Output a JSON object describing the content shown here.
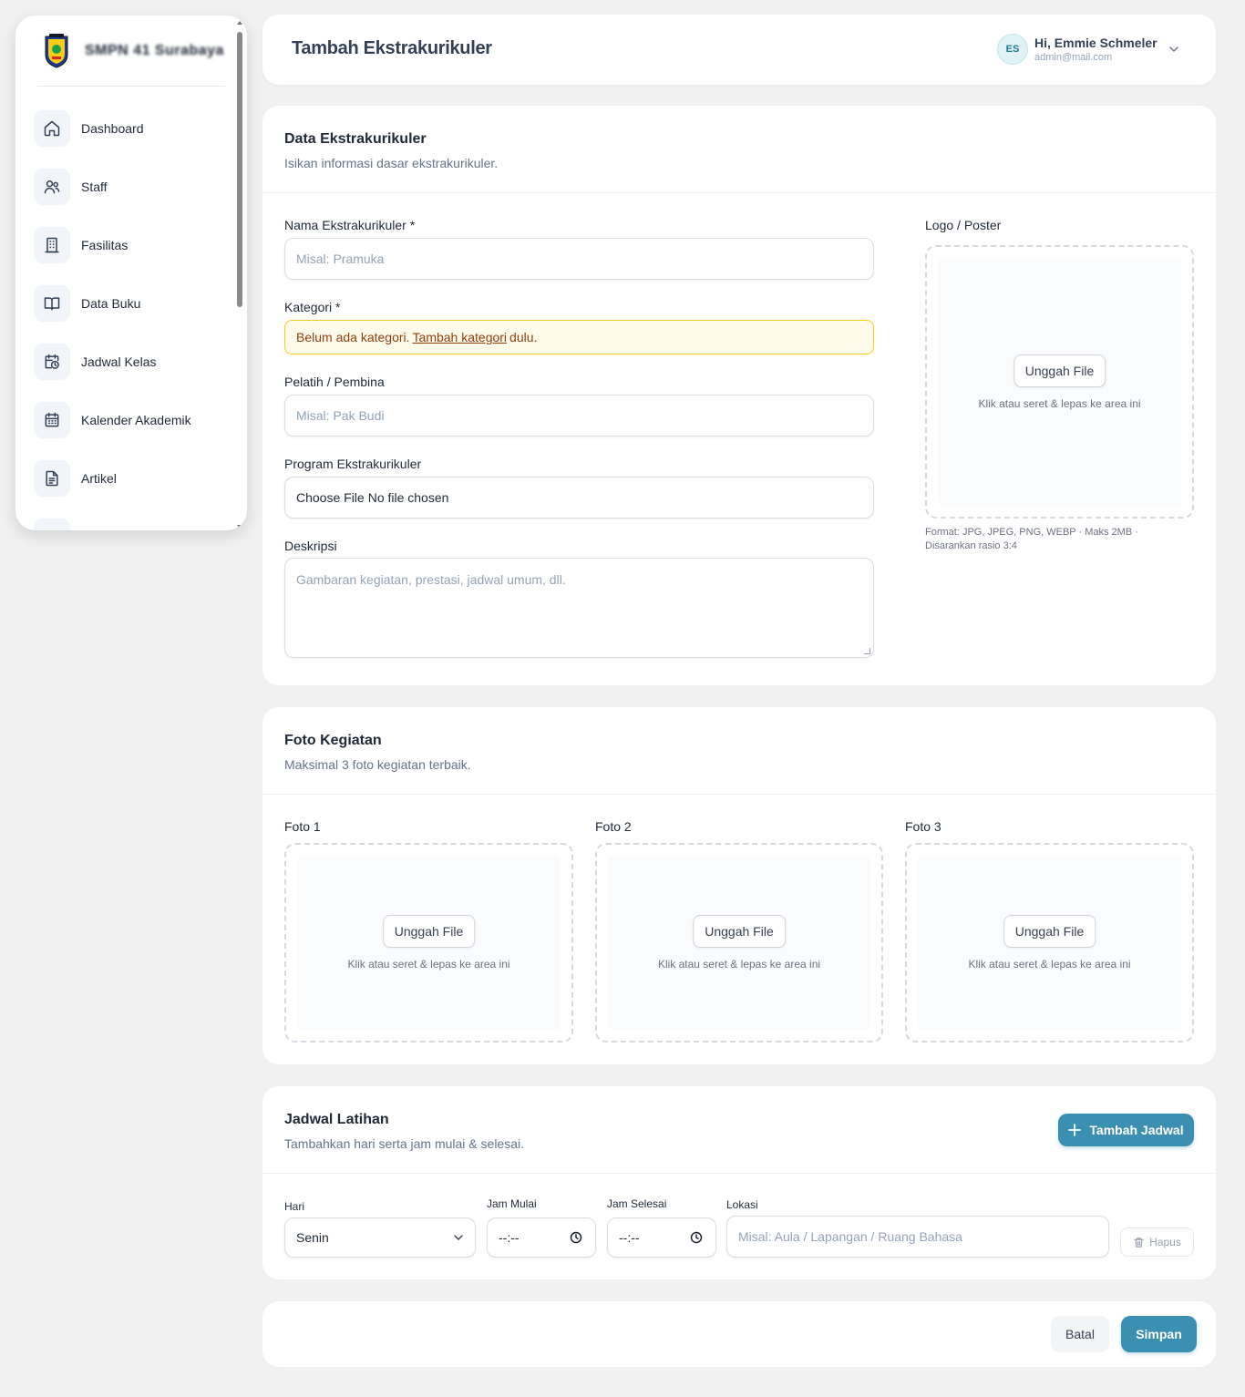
{
  "sidebar": {
    "brand": "SMPN 41 Surabaya",
    "items": [
      {
        "label": "Dashboard",
        "icon": "home-icon"
      },
      {
        "label": "Staff",
        "icon": "users-icon"
      },
      {
        "label": "Fasilitas",
        "icon": "building-icon"
      },
      {
        "label": "Data Buku",
        "icon": "book-open-icon"
      },
      {
        "label": "Jadwal Kelas",
        "icon": "calendar-clock-icon"
      },
      {
        "label": "Kalender Akademik",
        "icon": "calendar-icon"
      },
      {
        "label": "Artikel",
        "icon": "file-text-icon"
      }
    ]
  },
  "header": {
    "title": "Tambah Ekstrakurikuler",
    "user_initials": "ES",
    "user_greeting": "Hi, Emmie Schmeler",
    "user_email": "admin@mail.com"
  },
  "data_card": {
    "title": "Data Ekstrakurikuler",
    "subtitle": "Isikan informasi dasar ekstrakurikuler.",
    "nama_label": "Nama Ekstrakurikuler *",
    "nama_placeholder": "Misal: Pramuka",
    "kategori_label": "Kategori *",
    "kategori_warning_before": "Belum ada kategori.",
    "kategori_warning_link": "Tambah kategori",
    "kategori_warning_after": "dulu.",
    "pelatih_label": "Pelatih / Pembina",
    "pelatih_placeholder": "Misal: Pak Budi",
    "program_label": "Program Ekstrakurikuler",
    "program_file_button": "Choose File",
    "program_file_status": "No file chosen",
    "deskripsi_label": "Deskripsi",
    "deskripsi_placeholder": "Gambaran kegiatan, prestasi, jadwal umum, dll.",
    "logo_label": "Logo / Poster",
    "upload_button": "Unggah File",
    "upload_hint": "Klik atau seret & lepas ke area ini",
    "logo_note_line1": "Format: JPG, JPEG, PNG, WEBP · Maks 2MB ·",
    "logo_note_line2": "Disarankan rasio 3:4"
  },
  "foto_card": {
    "title": "Foto Kegiatan",
    "subtitle": "Maksimal 3 foto kegiatan terbaik.",
    "slots": [
      {
        "label": "Foto 1",
        "button": "Unggah File",
        "hint": "Klik atau seret & lepas ke area ini"
      },
      {
        "label": "Foto 2",
        "button": "Unggah File",
        "hint": "Klik atau seret & lepas ke area ini"
      },
      {
        "label": "Foto 3",
        "button": "Unggah File",
        "hint": "Klik atau seret & lepas ke area ini"
      }
    ]
  },
  "jadwal_card": {
    "title": "Jadwal Latihan",
    "subtitle": "Tambahkan hari serta jam mulai & selesai.",
    "add_button": "Tambah Jadwal",
    "hari_label": "Hari",
    "hari_value": "Senin",
    "jam_mulai_label": "Jam Mulai",
    "jam_mulai_value": "--:--",
    "jam_selesai_label": "Jam Selesai",
    "jam_selesai_value": "--:--",
    "lokasi_label": "Lokasi",
    "lokasi_placeholder": "Misal: Aula / Lapangan / Ruang Bahasa",
    "hapus_button": "Hapus"
  },
  "footer": {
    "cancel_button": "Batal",
    "save_button": "Simpan"
  },
  "colors": {
    "primary": "#3b8fb0",
    "warning_bg": "#fffbeb",
    "warning_border": "#facc15"
  }
}
